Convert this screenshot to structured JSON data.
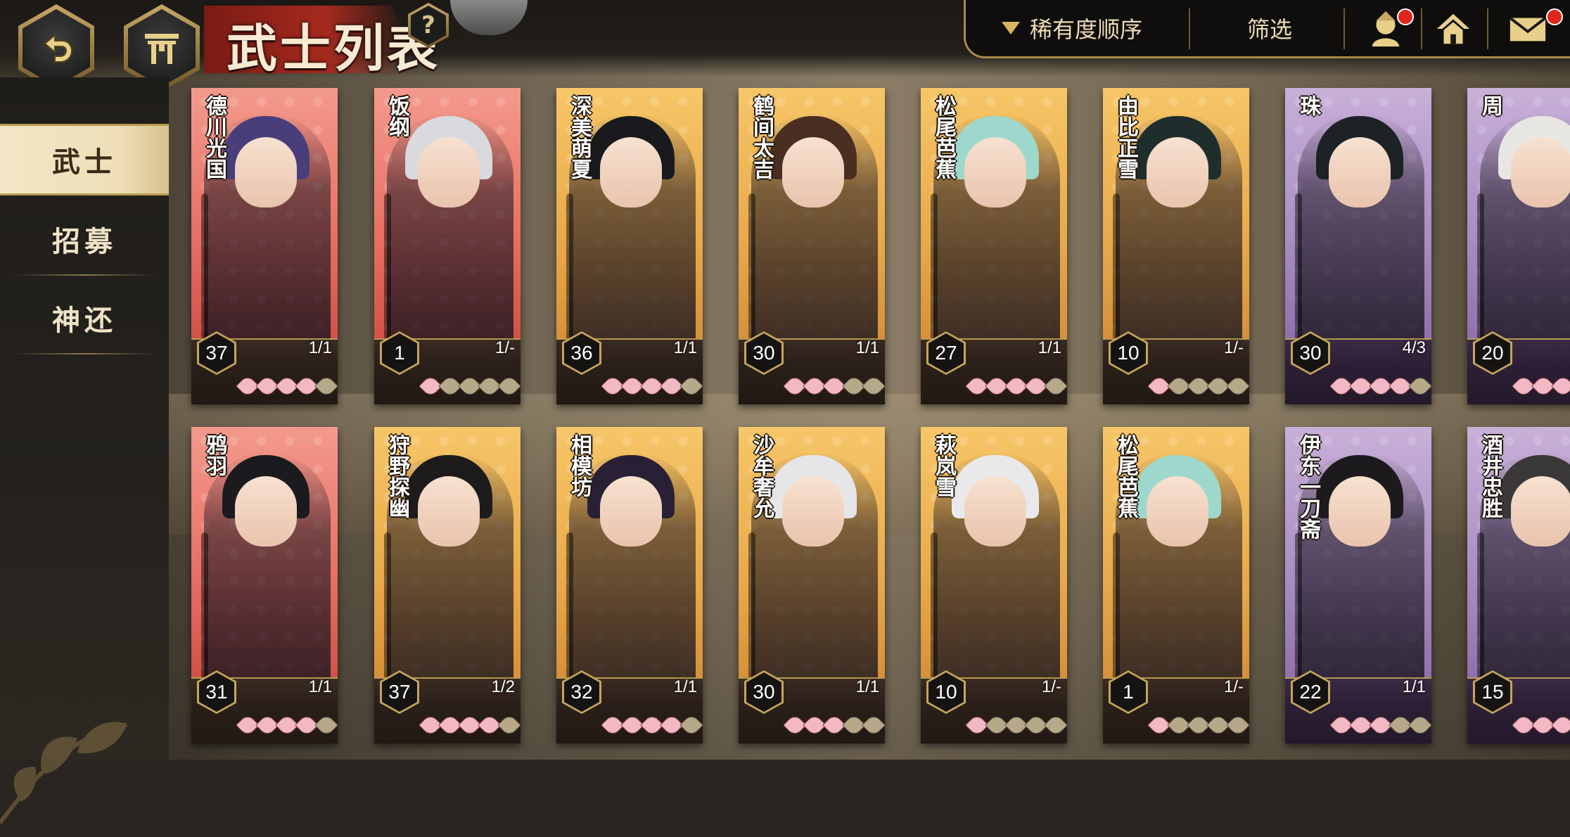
{
  "header": {
    "title": "武士列表",
    "help_label": "?",
    "sort_label": "稀有度顺序",
    "filter_label": "筛选"
  },
  "sidebar": {
    "items": [
      {
        "label": "武士",
        "active": true
      },
      {
        "label": "招募",
        "active": false
      },
      {
        "label": "神还",
        "active": false
      }
    ]
  },
  "colors": {
    "accent_gold": "#b7994f",
    "title_red": "#a52a1e",
    "notification_red": "#e1261c"
  },
  "cards": [
    {
      "name": "德川光国",
      "level": "37",
      "count": "1/1",
      "petals": 4,
      "frame": "red",
      "hair": "#4a3e7a"
    },
    {
      "name": "饭纲",
      "level": "1",
      "count": "1/-",
      "petals": 1,
      "frame": "red",
      "hair": "#d9d9de"
    },
    {
      "name": "深美萌夏",
      "level": "36",
      "count": "1/1",
      "petals": 4,
      "frame": "orange",
      "hair": "#1a1a1e"
    },
    {
      "name": "鹤间太吉",
      "level": "30",
      "count": "1/1",
      "petals": 3,
      "frame": "orange",
      "hair": "#4a2e22"
    },
    {
      "name": "松尾芭蕉",
      "level": "27",
      "count": "1/1",
      "petals": 4,
      "frame": "orange",
      "hair": "#9ed8cc"
    },
    {
      "name": "由比正雪",
      "level": "10",
      "count": "1/-",
      "petals": 1,
      "frame": "orange",
      "hair": "#1f2d2c"
    },
    {
      "name": "珠",
      "level": "30",
      "count": "4/3",
      "petals": 4,
      "frame": "purple",
      "hair": "#1c2226"
    },
    {
      "name": "周",
      "level": "20",
      "count": "",
      "petals": 3,
      "frame": "purple",
      "hair": "#e8e6e3"
    },
    {
      "name": "鸦羽",
      "level": "31",
      "count": "1/1",
      "petals": 4,
      "frame": "red",
      "hair": "#1b1a1e"
    },
    {
      "name": "狩野探幽",
      "level": "37",
      "count": "1/2",
      "petals": 4,
      "frame": "orange",
      "hair": "#1e1b1c"
    },
    {
      "name": "相模坊",
      "level": "32",
      "count": "1/1",
      "petals": 4,
      "frame": "orange",
      "hair": "#2a2036"
    },
    {
      "name": "沙牟奢允",
      "level": "30",
      "count": "1/1",
      "petals": 3,
      "frame": "orange",
      "hair": "#e6e6e8"
    },
    {
      "name": "萩岚雪",
      "level": "10",
      "count": "1/-",
      "petals": 1,
      "frame": "orange",
      "hair": "#e9e9ec"
    },
    {
      "name": "松尾芭蕉",
      "level": "1",
      "count": "1/-",
      "petals": 1,
      "frame": "orange",
      "hair": "#9ed8cc"
    },
    {
      "name": "伊东一刀斋",
      "level": "22",
      "count": "1/1",
      "petals": 3,
      "frame": "purple",
      "hair": "#1c1a1d"
    },
    {
      "name": "酒井忠胜",
      "level": "15",
      "count": "",
      "petals": 3,
      "frame": "purple",
      "hair": "#3a3838"
    }
  ]
}
